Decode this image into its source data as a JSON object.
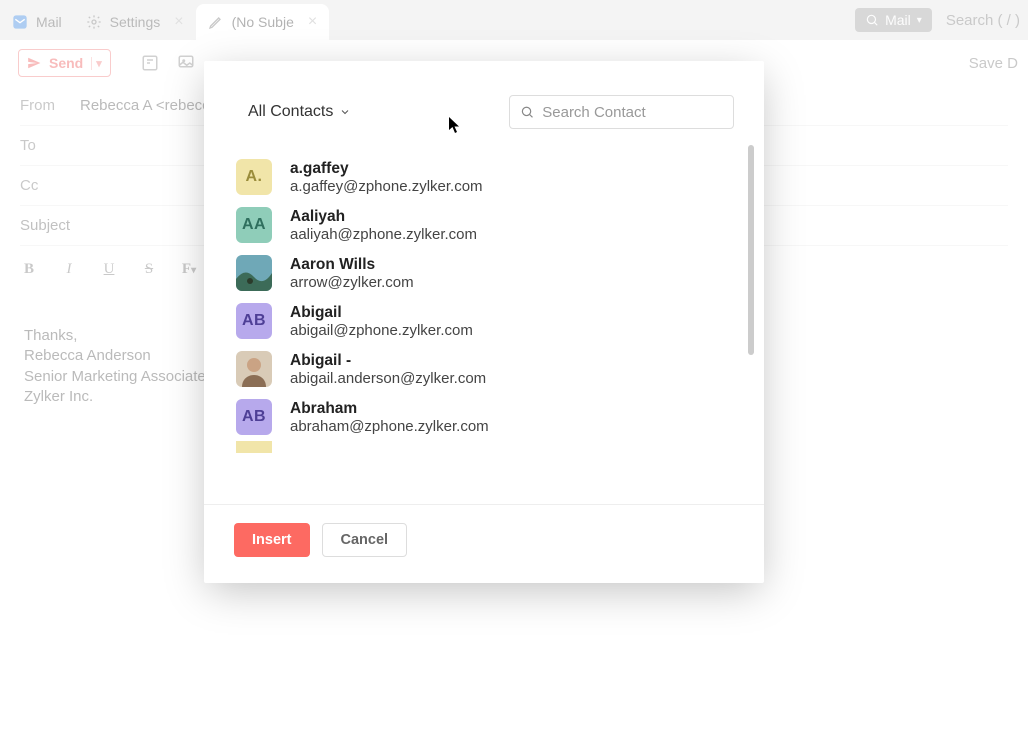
{
  "tabs": [
    {
      "label": "Mail",
      "icon": "mail"
    },
    {
      "label": "Settings",
      "icon": "gear"
    },
    {
      "label": "(No Subje",
      "icon": "pencil",
      "active": true
    }
  ],
  "global": {
    "switcher_label": "Mail",
    "search_hint": "Search ( / )"
  },
  "toolbar": {
    "send_label": "Send",
    "save_draft_label": "Save D"
  },
  "compose": {
    "from_label": "From",
    "from_value": "Rebecca A <rebecca@",
    "to_label": "To",
    "cc_label": "Cc",
    "subject_placeholder": "Subject",
    "font_size": "10"
  },
  "signature": {
    "line1": "Thanks,",
    "line2": "Rebecca Anderson",
    "line3": "Senior Marketing Associate",
    "line4": "Zylker Inc."
  },
  "modal": {
    "dropdown_label": "All Contacts",
    "search_placeholder": "Search Contact",
    "insert_label": "Insert",
    "cancel_label": "Cancel"
  },
  "contacts": [
    {
      "name": "a.gaffey",
      "email": "a.gaffey@zphone.zylker.com",
      "initials": "A.",
      "bg": "#f1e5a9",
      "fg": "#9a8c3a",
      "photo": false
    },
    {
      "name": "Aaliyah",
      "email": "aaliyah@zphone.zylker.com",
      "initials": "AA",
      "bg": "#8fcdb9",
      "fg": "#2f6f5e",
      "photo": false
    },
    {
      "name": "Aaron Wills",
      "email": "arrow@zylker.com",
      "initials": "",
      "bg": "#4f7f8f",
      "fg": "#fff",
      "photo": true,
      "photo_type": "landscape"
    },
    {
      "name": "Abigail",
      "email": "abigail@zphone.zylker.com",
      "initials": "AB",
      "bg": "#b7a9ec",
      "fg": "#4e3f96",
      "photo": false
    },
    {
      "name": "Abigail -",
      "email": "abigail.anderson@zylker.com",
      "initials": "",
      "bg": "#c7b9a0",
      "fg": "#fff",
      "photo": true,
      "photo_type": "person"
    },
    {
      "name": "Abraham",
      "email": "abraham@zphone.zylker.com",
      "initials": "AB",
      "bg": "#b7a9ec",
      "fg": "#4e3f96",
      "photo": false
    }
  ]
}
